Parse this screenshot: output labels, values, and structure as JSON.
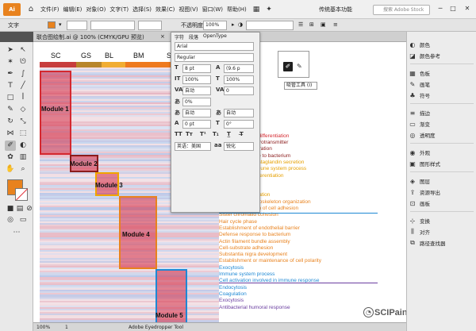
{
  "app": {
    "logo": "Ai"
  },
  "menubar": {
    "items": [
      "文件(F)",
      "编辑(E)",
      "对象(O)",
      "文字(T)",
      "选择(S)",
      "效果(C)",
      "视图(V)",
      "窗口(W)",
      "帮助(H)"
    ],
    "workspace": "传统基本功能",
    "search_placeholder": "搜索 Adobe Stock"
  },
  "control_bar": {
    "label": "文字",
    "opacity_label": "不透明度",
    "opacity_value": "100%"
  },
  "document": {
    "tab_title": "联合图绘制.ai @ 100% (CMYK/GPU 预览)",
    "close": "×"
  },
  "character_panel": {
    "tabs": [
      "字符",
      "段落",
      "OpenType"
    ],
    "font_family": "Arial",
    "font_style": "Regular",
    "font_size": "8 pt",
    "leading": "(9.6 p",
    "vertical_scale": "100%",
    "horizontal_scale": "100%",
    "kerning": "自动",
    "tracking": "0",
    "baseline": "0%",
    "auto1": "自动",
    "auto2": "自动",
    "shift": "0 pt",
    "rotation": "0°",
    "language": "英语：美国",
    "aa": "锐化"
  },
  "eyedropper_tooltip": "吸管工具 (I)",
  "right_panel": {
    "items": [
      "颜色",
      "颜色参考",
      "色板",
      "画笔",
      "符号",
      "描边",
      "渐变",
      "透明度",
      "外观",
      "图形样式",
      "图层",
      "资源导出",
      "画板",
      "变换",
      "对齐",
      "路径查找器"
    ]
  },
  "status_bar": {
    "zoom": "100%",
    "page": "1",
    "tool": "Adobe Eyedropper Tool"
  },
  "watermark": "SCIPainter",
  "chart_data": {
    "type": "heatmap",
    "columns": [
      "SC",
      "GS",
      "BL",
      "BM",
      "SI"
    ],
    "column_colors": [
      "#c73d3d",
      "#b8862b",
      "#f1ad33",
      "#ee7a1f",
      "#3a9bd9"
    ],
    "modules": [
      {
        "name": "Module 1",
        "color": "#d4282f"
      },
      {
        "name": "Module 2",
        "color": "#8b1c1c"
      },
      {
        "name": "Module 3",
        "color": "#f1a500"
      },
      {
        "name": "Module 4",
        "color": "#e8821e"
      },
      {
        "name": "Module 5",
        "color": "#1e88d4"
      }
    ],
    "go_terms": [
      {
        "text": "ing",
        "color": "#d4282f"
      },
      {
        "text": "cess",
        "color": "#d4282f"
      },
      {
        "text": "loss via skin",
        "color": "#d4282f"
      },
      {
        "text": "de production",
        "color": "#d4282f"
      },
      {
        "text": "intensity",
        "color": "#d4282f"
      },
      {
        "text": "otic cell death",
        "color": "#d4282f"
      },
      {
        "text": "n aging",
        "color": "#d4282f"
      },
      {
        "text": "entiation",
        "color": "#d4282f"
      },
      {
        "text": "ization",
        "color": "#d4282f"
      },
      {
        "text": "s system neuron differentiation",
        "color": "#d4282f"
      },
      {
        "text": "Exocytosis of neurotransmitter",
        "color": "#8b1c1c"
      },
      {
        "text": "Schwann cell migration",
        "color": "#8b1c1c"
      },
      {
        "text": "Defense response to bacterium",
        "color": "#8b1c1c"
      },
      {
        "text": "Regulation of prostaglandin secretion",
        "color": "#e6a000"
      },
      {
        "text": "Regulation of immune system process",
        "color": "#e6a000"
      },
      {
        "text": "Epidermal cell differentiation",
        "color": "#e6a000"
      },
      {
        "text": "Exocytosis",
        "color": "#e6a000"
      },
      {
        "text": "Wound healing",
        "color": "#e6a000"
      },
      {
        "text": "Hair follicle maturation",
        "color": "#e6a000"
      },
      {
        "text": "Neurofilament cytoskeleton organization",
        "color": "#e8821e"
      },
      {
        "text": "Positive regulation of cell adhesion",
        "color": "#e8821e"
      },
      {
        "text": "Sister chromatid cohesion",
        "color": "#e8821e"
      },
      {
        "text": "Hair cycle phase",
        "color": "#e8821e"
      },
      {
        "text": "Establishment of endothelial barrier",
        "color": "#e8821e"
      },
      {
        "text": "Defense response to bacterium",
        "color": "#e8821e"
      },
      {
        "text": "Actin filament bundle assembly",
        "color": "#e8821e"
      },
      {
        "text": "Cell-substrate adhesion",
        "color": "#e8821e"
      },
      {
        "text": "Substantia nigra development",
        "color": "#e8821e"
      },
      {
        "text": "Establishment or maintenance of cell polarity",
        "color": "#e8821e"
      },
      {
        "text": "Exocytosis",
        "color": "#1e88d4"
      },
      {
        "text": "Immune system process",
        "color": "#1e88d4"
      },
      {
        "text": "Cell activation involved in immune response",
        "color": "#1e88d4"
      },
      {
        "text": "Endocytosis",
        "color": "#1e88d4"
      },
      {
        "text": "Coagulation",
        "color": "#1e88d4"
      },
      {
        "text": "Exocytosis",
        "color": "#6b3fa0"
      },
      {
        "text": "Antibacterial humoral response",
        "color": "#6b3fa0"
      }
    ]
  }
}
